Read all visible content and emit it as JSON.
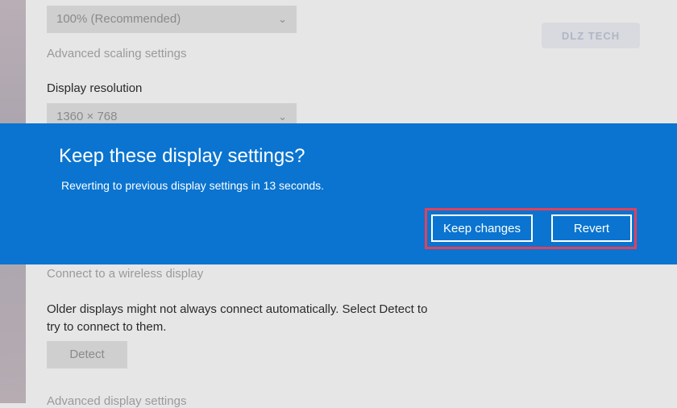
{
  "settings": {
    "scale_value": "100% (Recommended)",
    "advanced_scaling_link": "Advanced scaling settings",
    "resolution_label": "Display resolution",
    "resolution_value": "1360 × 768",
    "wireless_link": "Connect to a wireless display",
    "older_displays_line1": "Older displays might not always connect automatically. Select Detect to",
    "older_displays_line2": "try to connect to them.",
    "detect_label": "Detect",
    "advanced_display_link": "Advanced display settings"
  },
  "watermark": {
    "text": "DLZ TECH"
  },
  "dialog": {
    "title": "Keep these display settings?",
    "message": "Reverting to previous display settings in 13 seconds.",
    "keep_label": "Keep changes",
    "revert_label": "Revert",
    "bg_color": "#0a74d0",
    "highlight_color": "#e0415b"
  }
}
